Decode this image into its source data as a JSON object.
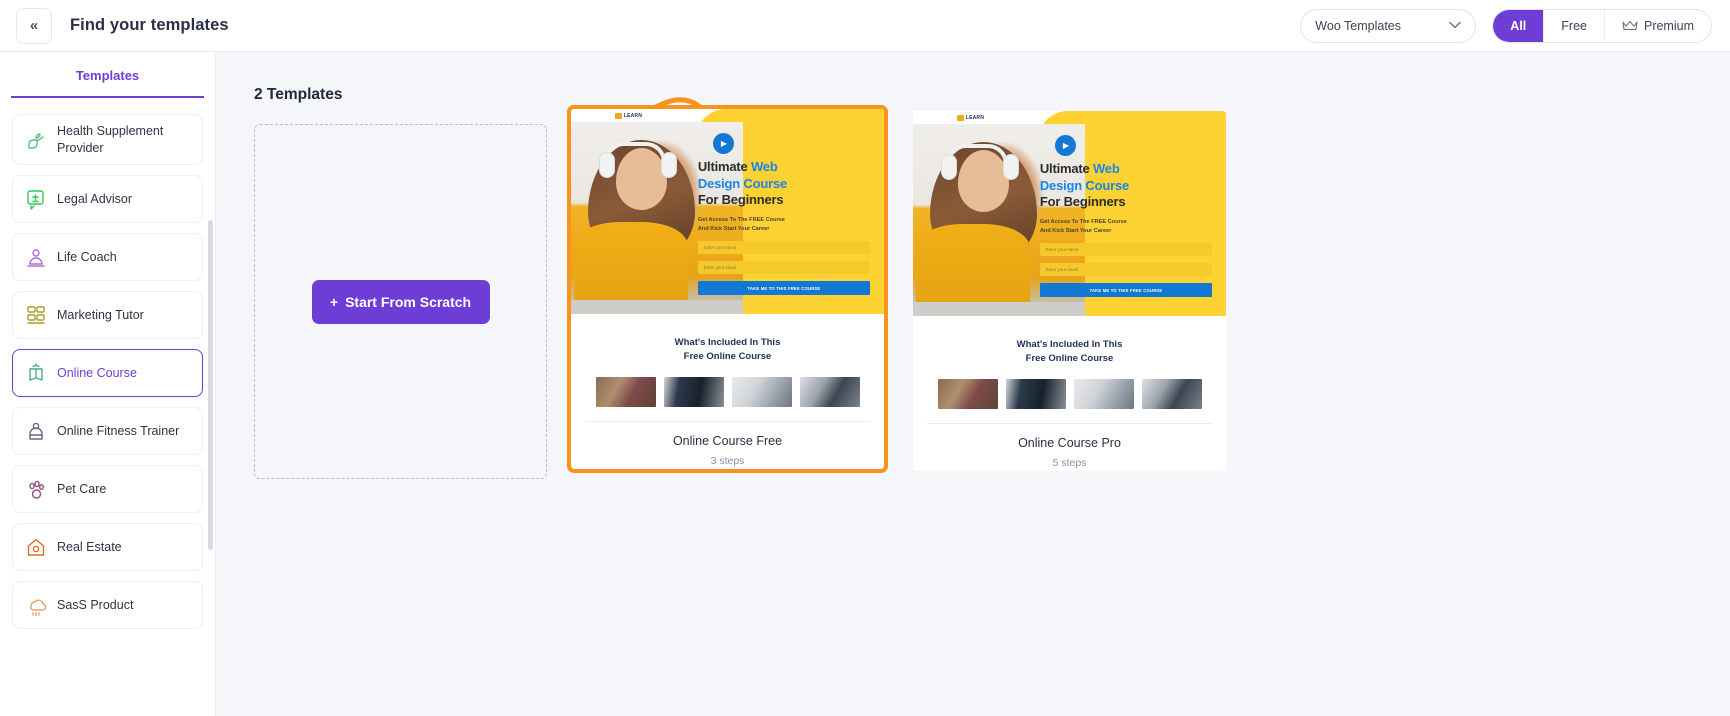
{
  "topbar": {
    "collapse_icon": "chevron-double-left-icon",
    "collapse_glyph": "«",
    "title": "Find your templates",
    "select": {
      "value": "Woo Templates",
      "chevron": "⌄"
    },
    "filters": [
      {
        "label": "All",
        "active": true,
        "icon": null
      },
      {
        "label": "Free",
        "active": false,
        "icon": null
      },
      {
        "label": "Premium",
        "active": false,
        "icon": "crown-icon"
      }
    ]
  },
  "sidebar": {
    "tab": "Templates",
    "items": [
      {
        "label": "Health Supplement Provider",
        "icon": "leaf-pills-icon",
        "color": "#5bbf7e",
        "selected": false
      },
      {
        "label": "Legal Advisor",
        "icon": "legal-chat-icon",
        "color": "#34c759",
        "selected": false
      },
      {
        "label": "Life Coach",
        "icon": "coach-person-icon",
        "color": "#b06ddb",
        "selected": false
      },
      {
        "label": "Marketing Tutor",
        "icon": "presentation-group-icon",
        "color": "#a9a12a",
        "selected": false
      },
      {
        "label": "Online Course",
        "icon": "open-book-icon",
        "color": "#4fae7d",
        "selected": true
      },
      {
        "label": "Online Fitness Trainer",
        "icon": "trainer-icon",
        "color": "#5e6b82",
        "selected": false
      },
      {
        "label": "Pet Care",
        "icon": "paw-icon",
        "color": "#8f4d7a",
        "selected": false
      },
      {
        "label": "Real Estate",
        "icon": "house-icon",
        "color": "#e06a2b",
        "selected": false
      },
      {
        "label": "SasS Product",
        "icon": "cloud-icon",
        "color": "#e0a36a",
        "selected": false
      }
    ]
  },
  "main": {
    "count_title": "2 Templates",
    "scratch_button": "Start From Scratch",
    "scratch_plus": "+",
    "annotation": {
      "type": "curved-arrow",
      "color": "#f7941e"
    },
    "highlight_color": "#f7941e"
  },
  "templates": [
    {
      "name": "Online Course Free",
      "steps": "3 steps",
      "highlighted": true,
      "preview": {
        "logo": "LEARN",
        "play_icon": "play-icon",
        "headline_1": "Ultimate ",
        "headline_1_accent": "Web",
        "headline_2": "Design Course",
        "headline_3": "For Beginners",
        "subtext_line1": "Get Access To The FREE Course",
        "subtext_line2": "And Kick Start Your Career",
        "field_name_placeholder": "Enter your name",
        "field_email_placeholder": "Enter your email",
        "cta": "TAKE ME TO THIS FREE COURSE",
        "section_title_line1": "What's Included In This",
        "section_title_line2": "Free Online Course"
      }
    },
    {
      "name": "Online Course Pro",
      "steps": "5 steps",
      "highlighted": false,
      "preview": {
        "logo": "LEARN",
        "play_icon": "play-icon",
        "headline_1": "Ultimate ",
        "headline_1_accent": "Web",
        "headline_2": "Design Course",
        "headline_3": "For Beginners",
        "subtext_line1": "Get Access To The FREE Course",
        "subtext_line2": "And Kick Start Your Career",
        "field_name_placeholder": "Enter your name",
        "field_email_placeholder": "Enter your email",
        "cta": "TAKE ME TO THIS FREE COURSE",
        "section_title_line1": "What's Included In This",
        "section_title_line2": "Free Online Course"
      }
    }
  ]
}
